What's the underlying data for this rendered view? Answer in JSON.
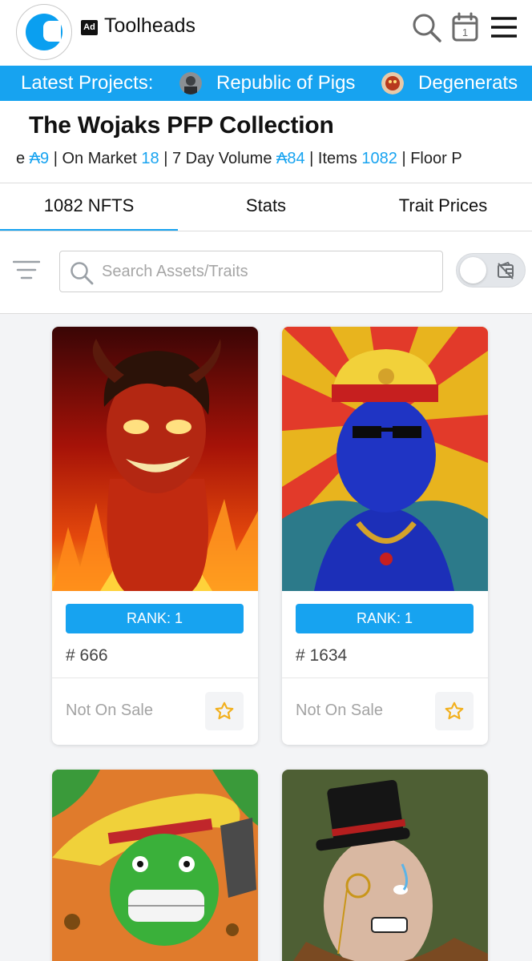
{
  "header": {
    "ad_badge": "Ad",
    "brand": "Toolheads",
    "icons": [
      "logo-icon",
      "search-icon",
      "calendar-icon",
      "menu-icon"
    ],
    "calendar_day": "1"
  },
  "ticker": {
    "label": "Latest Projects:",
    "projects": [
      "Republic of Pigs",
      "Degenerats"
    ]
  },
  "collection": {
    "title": "The Wojaks PFP Collection",
    "stats": {
      "prefix": "e ",
      "currency": "₳",
      "v1": "9",
      "on_market_label": " | On Market ",
      "on_market": "18",
      "volume_label": " | 7 Day Volume ",
      "volume": "84",
      "items_label": " | Items ",
      "items": "1082",
      "floor_label": " | Floor P"
    }
  },
  "tabs": [
    {
      "label": "1082 NFTS",
      "active": true
    },
    {
      "label": "Stats",
      "active": false
    },
    {
      "label": "Trait Prices",
      "active": false
    }
  ],
  "search": {
    "placeholder": "Search Assets/Traits"
  },
  "cards": [
    {
      "rank": "RANK: 1",
      "id": "# 666",
      "sale": "Not On Sale"
    },
    {
      "rank": "RANK: 1",
      "id": "# 1634",
      "sale": "Not On Sale"
    },
    {
      "rank": "",
      "id": "",
      "sale": ""
    },
    {
      "rank": "",
      "id": "",
      "sale": ""
    }
  ],
  "colors": {
    "accent": "#17a3f0",
    "star": "#f2b01e"
  }
}
